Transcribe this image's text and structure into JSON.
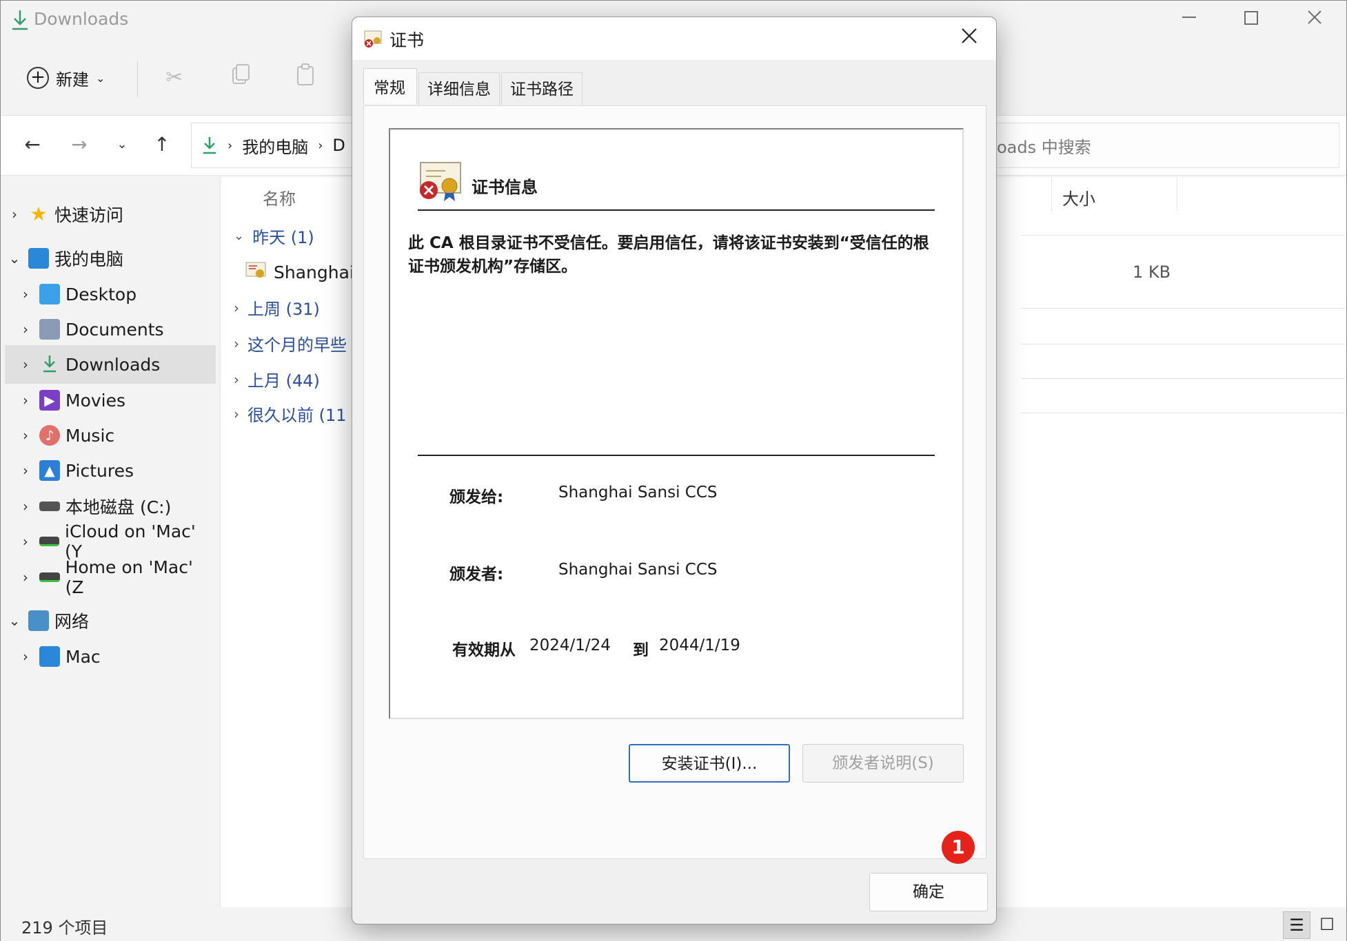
{
  "explorer": {
    "title": "Downloads",
    "toolbar": {
      "new_label": "新建"
    },
    "address": {
      "segments": [
        "我的电脑",
        "D"
      ]
    },
    "search": {
      "placeholder_partial": "oads 中搜索"
    },
    "columns": {
      "name": "名称",
      "size": "大小"
    },
    "sidebar": {
      "quick_access": "快速访问",
      "this_pc": "我的电脑",
      "items": [
        {
          "label": "Desktop"
        },
        {
          "label": "Documents"
        },
        {
          "label": "Downloads"
        },
        {
          "label": "Movies"
        },
        {
          "label": "Music"
        },
        {
          "label": "Pictures"
        },
        {
          "label": "本地磁盘 (C:)"
        },
        {
          "label": "iCloud on 'Mac' (Y"
        },
        {
          "label": "Home on 'Mac' (Z"
        }
      ],
      "network": "网络",
      "network_items": [
        {
          "label": "Mac"
        }
      ]
    },
    "groups": [
      {
        "label": "昨天 (1)"
      },
      {
        "label": "上周 (31)"
      },
      {
        "label": "这个月的早些"
      },
      {
        "label": "上月 (44)"
      },
      {
        "label": "很久以前 (11"
      }
    ],
    "file": {
      "name": "Shanghai",
      "size": "1 KB"
    },
    "status": {
      "count": "219 个项目"
    }
  },
  "dialog": {
    "title": "证书",
    "tabs": [
      "常规",
      "详细信息",
      "证书路径"
    ],
    "heading": "证书信息",
    "warning": "此 CA 根目录证书不受信任。要启用信任，请将该证书安装到“受信任的根证书颁发机构”存储区。",
    "issued_to_label": "颁发给:",
    "issued_to": "Shanghai Sansi CCS",
    "issued_by_label": "颁发者:",
    "issued_by": "Shanghai Sansi CCS",
    "valid_from_label": "有效期从",
    "valid_from": "2024/1/24",
    "valid_to_label": "到",
    "valid_to": "2044/1/19",
    "install_button": "安装证书(I)...",
    "issuer_statement_button": "颁发者说明(S)",
    "ok_button": "确定",
    "badge": "1"
  },
  "colors": {
    "accent": "#2f6fbe",
    "badge": "#e5231b",
    "group_text": "#2a4fa0"
  }
}
